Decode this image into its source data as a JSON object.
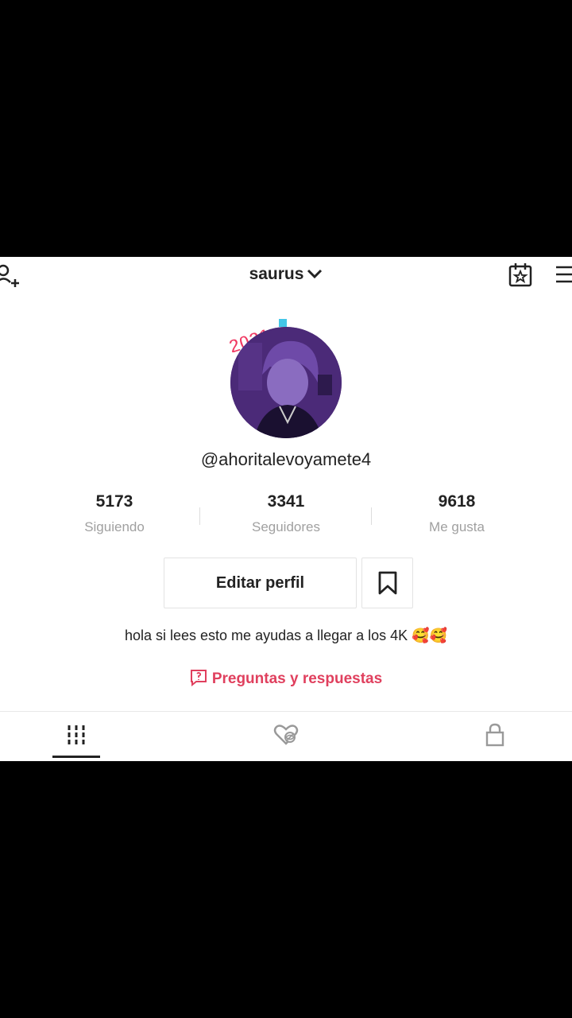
{
  "header": {
    "account_name": "saurus",
    "icons": [
      "add-user-icon",
      "calendar-star-icon",
      "menu-icon"
    ]
  },
  "profile": {
    "avatar_badge": "2021",
    "username": "@ahoritalevoyamete4",
    "stats": [
      {
        "value": "5173",
        "label": "Siguiendo"
      },
      {
        "value": "3341",
        "label": "Seguidores"
      },
      {
        "value": "9618",
        "label": "Me gusta"
      }
    ],
    "edit_button": "Editar perfil",
    "bio": "hola si lees esto me ayudas a llegar a los 4K 🥰🥰",
    "qa_link": "Preguntas y respuestas"
  },
  "tabs": [
    "videos-grid-icon",
    "liked-hidden-icon",
    "lock-icon"
  ],
  "colors": {
    "accent": "#e0405e",
    "avatar_bg": "#4b2a78"
  }
}
